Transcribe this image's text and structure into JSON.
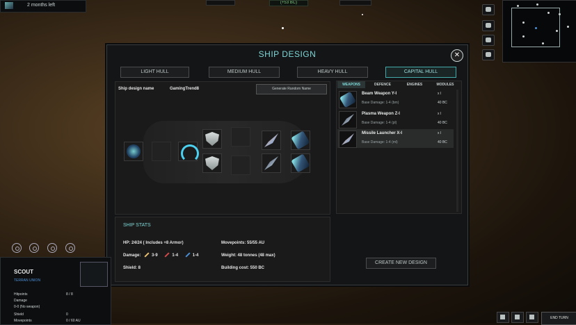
{
  "topbar": {
    "time_left": "2 months left",
    "credits": "(+53 BC)"
  },
  "modal": {
    "title": "SHIP DESIGN",
    "close_icon": "close-icon",
    "hulls": [
      "LIGHT HULL",
      "MEDIUM HULL",
      "HEAVY HULL",
      "CAPITAL HULL"
    ],
    "active_hull": "CAPITAL HULL",
    "design_name_label": "Ship design name",
    "design_name_value": "GamingTrend8",
    "generate_button": "Generate Random Name",
    "weapon_tabs": [
      "WEAPONS",
      "DEFENCE",
      "ENGINES",
      "MODULES"
    ],
    "weapons": [
      {
        "name": "Beam Weapon Y-I",
        "count": "x I",
        "damage": "Base Damage: 1-4 (bm)",
        "cost": "40 BC"
      },
      {
        "name": "Plasma Weapon Z-I",
        "count": "x I",
        "damage": "Base Damage: 1-4 (pl)",
        "cost": "40 BC"
      },
      {
        "name": "Missile Launcher X-I",
        "count": "x I",
        "damage": "Base Damage: 1-4 (ml)",
        "cost": "40 BC"
      }
    ],
    "stats": {
      "heading": "SHIP STATS",
      "hp": "HP: 24/24 ( Includes +8 Armor)",
      "damage_label": "Damage:",
      "damage_values": [
        "3-9",
        "1-4",
        "1-4"
      ],
      "shield": "Shield: 8",
      "movepoints": "Movepoints: 55/55 AU",
      "weight": "Weight: 48 tonnes (48 max)",
      "building_cost": "Building cost: 550 BC"
    },
    "create_button": "CREATE NEW DESIGN"
  },
  "unit_panel": {
    "name": "SCOUT",
    "faction": "TERRAN UNION",
    "rows": [
      {
        "label": "Hitpoints",
        "value": "8 / 8"
      },
      {
        "label": "Damage",
        "value": ""
      },
      {
        "label": "0-0 (No weapon)",
        "value": ""
      },
      {
        "label": "Shield",
        "value": "0"
      },
      {
        "label": "Movepoints",
        "value": "0 / 60 AU"
      }
    ]
  },
  "end_turn": "END TURN"
}
